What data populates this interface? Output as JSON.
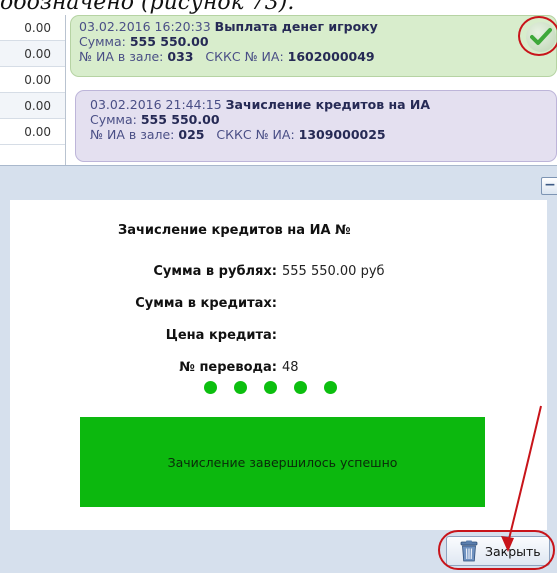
{
  "caption": {
    "text": "обозначено (рисунок 73)."
  },
  "values_column": [
    "0.00",
    "0.00",
    "0.00",
    "0.00",
    "0.00"
  ],
  "log_entries": [
    {
      "datetime": "03.02.2016 16:20:33",
      "title": "Выплата денег игроку",
      "sum_label": "Сумма:",
      "sum_value": "555 550.00",
      "hall_label": "№ ИА в зале:",
      "hall_value": "033",
      "skks_label": "СККС № ИА:",
      "skks_value": "1602000049",
      "status_icon": "check-icon"
    },
    {
      "datetime": "03.02.2016 21:44:15",
      "title": "Зачисление кредитов на ИА",
      "sum_label": "Сумма:",
      "sum_value": "555 550.00",
      "hall_label": "№ ИА в зале:",
      "hall_value": "025",
      "skks_label": "СККС № ИА:",
      "skks_value": "1309000025"
    }
  ],
  "dialog": {
    "collapse_label": "−",
    "title": "Зачисление кредитов на ИА №",
    "fields": {
      "sum_rub_label": "Сумма в рублях:",
      "sum_rub_value": "555 550.00 руб",
      "sum_credits_label": "Сумма в кредитах:",
      "sum_credits_value": "",
      "credit_price_label": "Цена кредита:",
      "credit_price_value": "",
      "transfer_no_label": "№ перевода:",
      "transfer_no_value": "48"
    },
    "progress_dots": 5,
    "status_message": "Зачисление завершилось успешно",
    "close_button": "Закрыть"
  },
  "colors": {
    "payout_card": "#d8edcc",
    "credit_card": "#e4e0f0",
    "success": "#0cb80e",
    "annotation": "#c8141a"
  }
}
